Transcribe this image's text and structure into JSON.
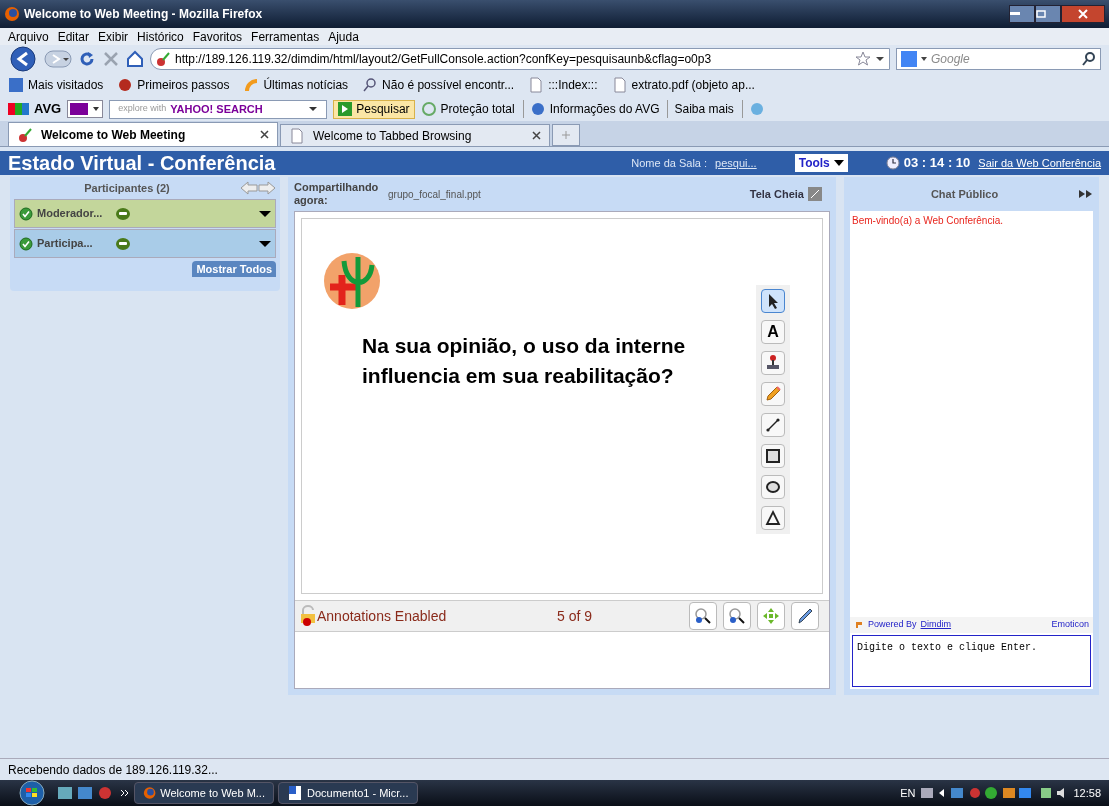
{
  "window": {
    "title": "Welcome to Web Meeting - Mozilla Firefox"
  },
  "menu": [
    "Arquivo",
    "Editar",
    "Exibir",
    "Histórico",
    "Favoritos",
    "Ferramentas",
    "Ajuda"
  ],
  "address_bar": {
    "value": "http://189.126.119.32/dimdim/html/layout2/GetFullConsole.action?confKey=pesquisaunb&cflag=o0p3"
  },
  "search": {
    "placeholder": "Google"
  },
  "bookmarks": [
    "Mais visitados",
    "Primeiros passos",
    "Últimas notícias",
    "Não é possível encontr...",
    ":::Index:::",
    "extrato.pdf (objeto ap..."
  ],
  "avg_toolbar": {
    "brand": "AVG",
    "search_placeholder": "explore with",
    "search_logo": "YAHOO! SEARCH",
    "search_button": "Pesquisar",
    "items": [
      "Proteção total",
      "Informações do AVG",
      "Saiba mais"
    ]
  },
  "tabs": [
    {
      "label": "Welcome to Web Meeting",
      "selected": true
    },
    {
      "label": "Welcome to Tabbed Browsing",
      "selected": false
    }
  ],
  "app": {
    "title": "Estado Virtual - Conferência",
    "room_label": "Nome da Sala :",
    "room_name": "pesqui...",
    "tools": "Tools",
    "timer": "03 : 14 : 10",
    "exit_link": "Sair da Web Conferência"
  },
  "participants": {
    "title": "Participantes (2)",
    "show_all": "Mostrar Todos",
    "items": [
      {
        "name": "Moderador...",
        "color": "#c3d69b"
      },
      {
        "name": "Participa...",
        "color": "#a9cce8"
      }
    ]
  },
  "presentation": {
    "label": "Compartilhando agora:",
    "file": "grupo_focal_final.ppt",
    "fullscreen": "Tela Cheia",
    "slide_lines": [
      "Na sua opinião, o uso da interne",
      "influencia em sua reabilitação?"
    ],
    "tools": [
      {
        "kind": "pointer",
        "selected": true
      },
      {
        "kind": "text",
        "label": "A",
        "selected": false
      },
      {
        "kind": "stamp",
        "selected": false
      },
      {
        "kind": "pencil",
        "selected": false
      },
      {
        "kind": "line",
        "selected": false
      },
      {
        "kind": "rectangle",
        "selected": false
      },
      {
        "kind": "ellipse",
        "selected": false
      },
      {
        "kind": "triangle",
        "selected": false
      }
    ],
    "annotations": "Annotations Enabled",
    "page": "5 of 9"
  },
  "chat": {
    "title": "Chat Público",
    "messages": [
      "Bem-vindo(a) a Web Conferência."
    ],
    "powered_by": "Powered By",
    "powered_link": "Dimdim",
    "emoticon": "Emoticon",
    "input": "Digite o texto e clique Enter."
  },
  "status_bar": "Recebendo dados de 189.126.119.32...",
  "taskbar": {
    "windows": [
      "Welcome to Web M...",
      "Documento1 - Micr..."
    ],
    "language": "EN",
    "clock": "12:58"
  }
}
